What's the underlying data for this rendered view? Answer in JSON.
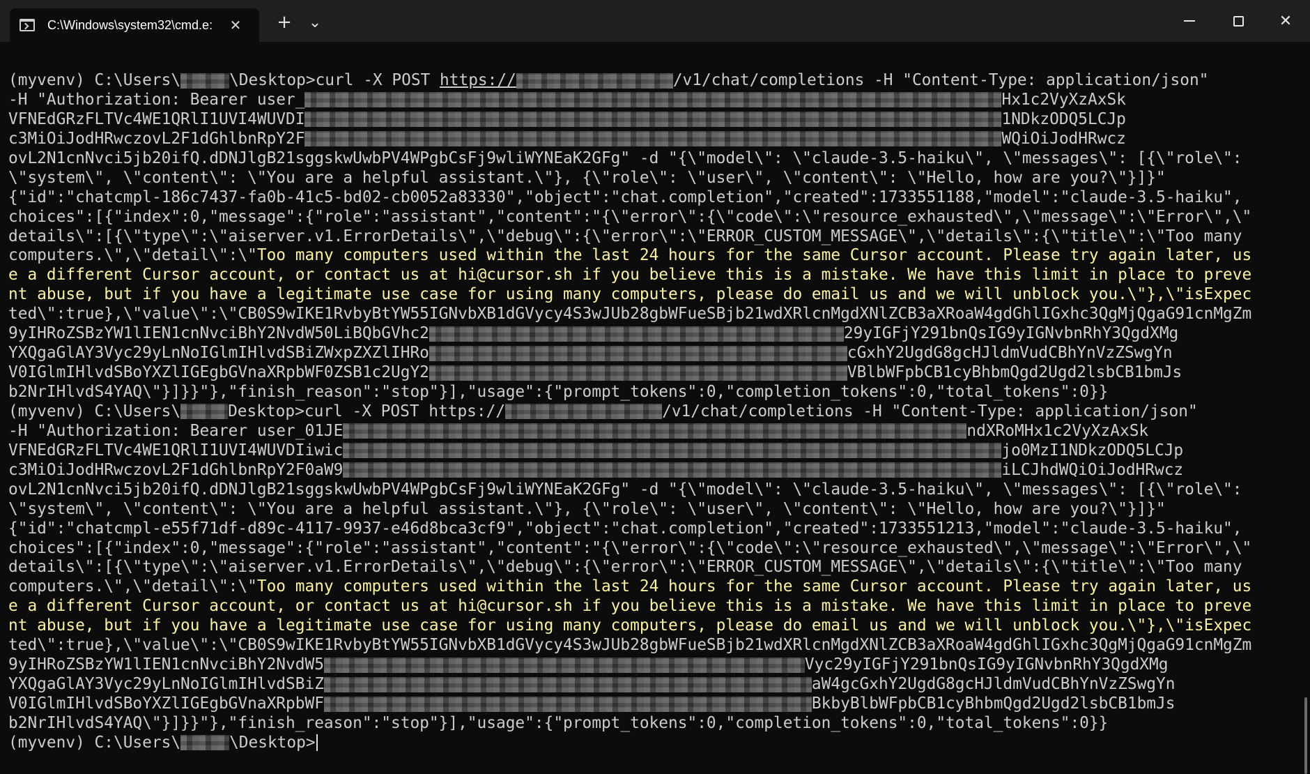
{
  "window": {
    "tab_title": "C:\\Windows\\system32\\cmd.e:",
    "tab_icon": "terminal-icon",
    "close_tab_glyph": "✕",
    "new_tab_glyph": "+",
    "dropdown_glyph": "⌄",
    "minimize_label": "Minimize",
    "maximize_label": "Maximize",
    "close_glyph": "✕"
  },
  "colors": {
    "background": "#0c0c0c",
    "text": "#cccccc",
    "warning_text": "#f9f1a5",
    "titlebar": "#1f1f1f"
  },
  "terminal": {
    "lines": [
      {
        "a": "(myvenv) C:\\Users\\",
        "b": "\\Desktop>curl -X POST ",
        "link": "https://",
        "c": "/v1/chat/completions",
        "d": " -H \"Content-Type: application/json\""
      },
      {
        "a": "-H \"Authorization: Bearer user_",
        "b": "Hx1c2VyXzAxSk"
      },
      {
        "a": "VFNEdGRzFLTVc4WE1QRlI1UVI4WUVDI",
        "b": "1NDkzODQ5LCJp"
      },
      {
        "a": "c3MiOiJodHRwczovL2F1dGhlbnRpY2F",
        "b": "WQiOiJodHRwcz"
      },
      {
        "text": "ovL2N1cnNvci5jb20ifQ.dDNJlgB21sggskwUwbPV4WPgbCsFj9wliWYNEaK2GFg\" -d \"{\\\"model\\\": \\\"claude-3.5-haiku\\\", \\\"messages\\\": [{\\\"role\\\":"
      },
      {
        "text": "\\\"system\\\", \\\"content\\\": \\\"You are a helpful assistant.\\\"}, {\\\"role\\\": \\\"user\\\", \\\"content\\\": \\\"Hello, how are you?\\\"}]}\""
      },
      {
        "text": "{\"id\":\"chatcmpl-186c7437-fa0b-41c5-bd02-cb0052a83330\",\"object\":\"chat.completion\",\"created\":1733551188,\"model\":\"claude-3.5-haiku\","
      },
      {
        "text": "choices\":[{\"index\":0,\"message\":{\"role\":\"assistant\",\"content\":\"{\\\"error\\\":{\\\"code\\\":\\\"resource_exhausted\\\",\\\"message\\\":\\\"Error\\\",\\\""
      },
      {
        "text": "details\\\":[{\\\"type\\\":\\\"aiserver.v1.ErrorDetails\\\",\\\"debug\\\":{\\\"error\\\":\\\"ERROR_CUSTOM_MESSAGE\\\",\\\"details\\\":{\\\"title\\\":\\\"Too many"
      },
      {
        "a": "computers.\\\",\\\"detail\\\":\\\"",
        "w": "Too many computers used within the last 24 hours for the same Cursor account. Please try again later, us"
      },
      {
        "warn": "e a different Cursor account, or contact us at hi@cursor.sh if you believe this is a mistake. We have this limit in place to preve"
      },
      {
        "warn": "nt abuse, but if you have a legitimate use case for using many computers, please do email us and we will unblock you.\\\"},\\\"isExpec"
      },
      {
        "text": "ted\\\":true},\\\"value\\\":\\\"CB0S9wIKE1RvbyBtYW55IGNvbXB1dGVycy4S3wJUb28gbWFueSBjb21wdXRlcnMgdXNlZCB3aXRoaW4gdGhlIGxhc3QgMjQgaG91cnMgZm"
      },
      {
        "a": "9yIHRoZSBzYW1lIEN1cnNvciBhY2NvdW50LiBQbGVhc2",
        "b": "29yIGFjY291bnQsIG9yIGNvbnRhY3QgdXMg"
      },
      {
        "a": "YXQgaGlAY3Vyc29yLnNoIGlmIHlvdSBiZWxpZXZlIHRo",
        "b": "cGxhY2UgdG8gcHJldmVudCBhYnVzZSwgYn"
      },
      {
        "a": "V0IGlmIHlvdSBoYXZlIGEgbGVnaXRpbWF0ZSB1c2UgY2",
        "b": "VBlbWFpbCB1cyBhbmQgd2Ugd2lsbCB1bmJs"
      },
      {
        "text": "b2NrIHlvdS4YAQ\\\"}]}}\"},\"finish_reason\":\"stop\"}],\"usage\":{\"prompt_tokens\":0,\"completion_tokens\":0,\"total_tokens\":0}}"
      },
      {
        "a": "(myvenv) C:\\Users\\",
        "b": "Desktop>curl -X POST https://",
        "c": "/v1/chat/completions -H \"Content-Type: application/json\""
      },
      {
        "a": "-H \"Authorization: Bearer user_01JE",
        "b": "ndXRoMHx1c2VyXzAxSk"
      },
      {
        "a": "VFNEdGRzFLTVc4WE1QRlI1UVI4WUVDIiwic",
        "b": "jo0MzI1NDkzODQ5LCJp"
      },
      {
        "a": "c3MiOiJodHRwczovL2F1dGhlbnRpY2F0aW9",
        "b": "iLCJhdWQiOiJodHRwcz"
      },
      {
        "text": "ovL2N1cnNvci5jb20ifQ.dDNJlgB21sggskwUwbPV4WPgbCsFj9wliWYNEaK2GFg\" -d \"{\\\"model\\\": \\\"claude-3.5-haiku\\\", \\\"messages\\\": [{\\\"role\\\":"
      },
      {
        "text": "\\\"system\\\", \\\"content\\\": \\\"You are a helpful assistant.\\\"}, {\\\"role\\\": \\\"user\\\", \\\"content\\\": \\\"Hello, how are you?\\\"}]}\""
      },
      {
        "text": "{\"id\":\"chatcmpl-e55f71df-d89c-4117-9937-e46d8bca3cf9\",\"object\":\"chat.completion\",\"created\":1733551213,\"model\":\"claude-3.5-haiku\","
      },
      {
        "text": "choices\":[{\"index\":0,\"message\":{\"role\":\"assistant\",\"content\":\"{\\\"error\\\":{\\\"code\\\":\\\"resource_exhausted\\\",\\\"message\\\":\\\"Error\\\",\\\""
      },
      {
        "text": "details\\\":[{\\\"type\\\":\\\"aiserver.v1.ErrorDetails\\\",\\\"debug\\\":{\\\"error\\\":\\\"ERROR_CUSTOM_MESSAGE\\\",\\\"details\\\":{\\\"title\\\":\\\"Too many"
      },
      {
        "a": "computers.\\\",\\\"detail\\\":\\\"",
        "w": "Too many computers used within the last 24 hours for the same Cursor account. Please try again later, us"
      },
      {
        "warn": "e a different Cursor account, or contact us at hi@cursor.sh if you believe this is a mistake. We have this limit in place to preve"
      },
      {
        "warn": "nt abuse, but if you have a legitimate use case for using many computers, please do email us and we will unblock you.\\\"},\\\"isExpec"
      },
      {
        "text": "ted\\\":true},\\\"value\\\":\\\"CB0S9wIKE1RvbyBtYW55IGNvbXB1dGVycy4S3wJUb28gbWFueSBjb21wdXRlcnMgdXNlZCB3aXRoaW4gdGhlIGxhc3QgMjQgaG91cnMgZm"
      },
      {
        "a": "9yIHRoZSBzYW1lIEN1cnNvciBhY2NvdW5",
        "b": "Vyc29yIGFjY291bnQsIG9yIGNvbnRhY3QgdXMg"
      },
      {
        "a": "YXQgaGlAY3Vyc29yLnNoIGlmIHlvdSBiZ",
        "b": "aW4gcGxhY2UgdG8gcHJldmVudCBhYnVzZSwgYn"
      },
      {
        "a": "V0IGlmIHlvdSBoYXZlIGEgbGVnaXRpbWF",
        "b": "BkbyBlbWFpbCB1cyBhbmQgd2Ugd2lsbCB1bmJs"
      },
      {
        "text": "b2NrIHlvdS4YAQ\\\"}]}}\"},\"finish_reason\":\"stop\"}],\"usage\":{\"prompt_tokens\":0,\"completion_tokens\":0,\"total_tokens\":0}}"
      },
      {
        "a": "(myvenv) C:\\Users\\",
        "b": "\\Desktop>"
      }
    ]
  }
}
